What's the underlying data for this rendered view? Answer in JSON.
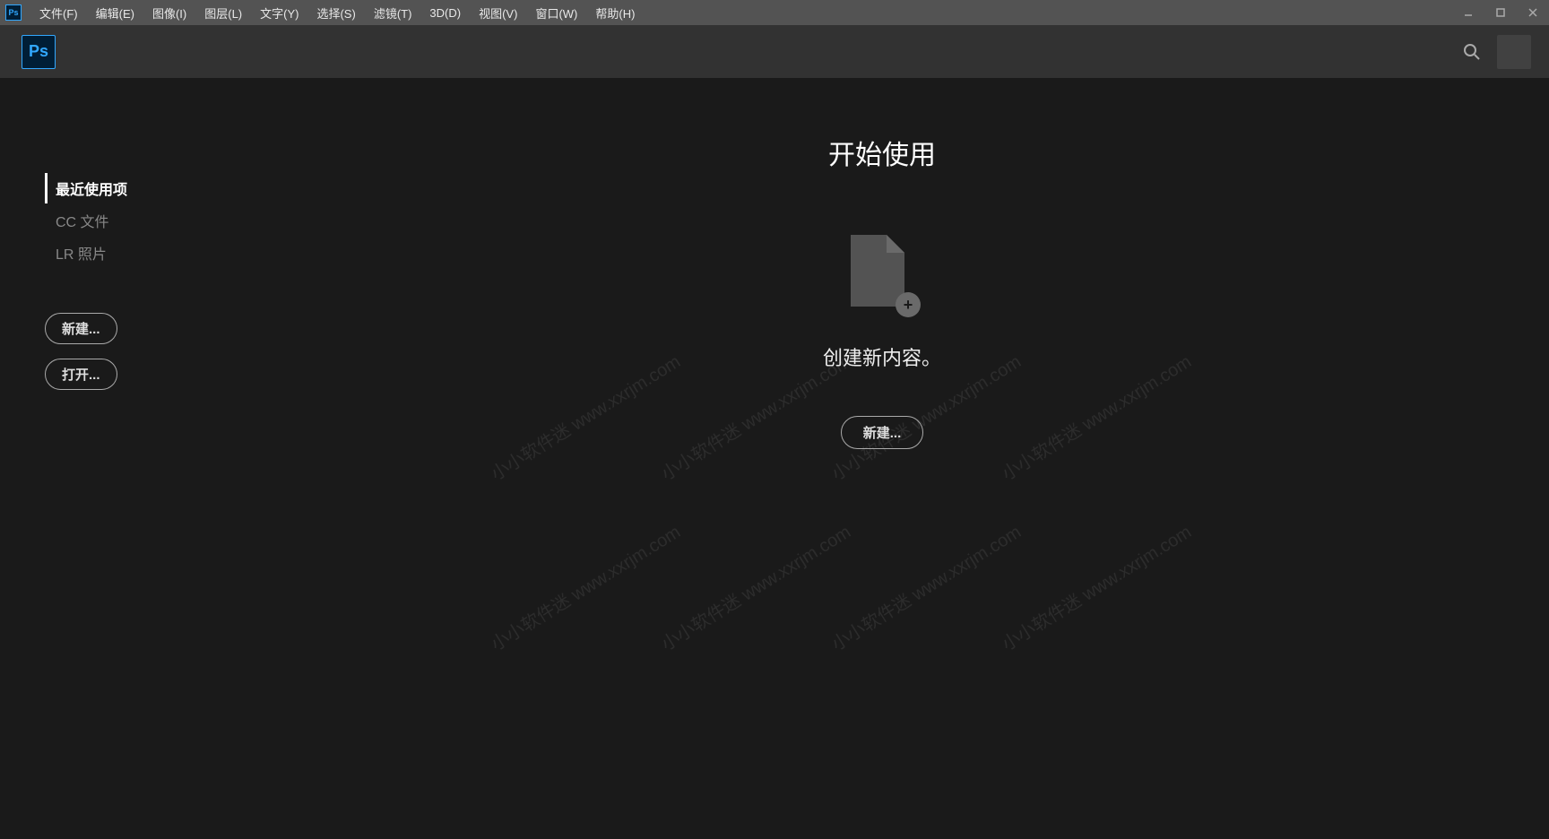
{
  "app_icon": "Ps",
  "menu": {
    "file": "文件(F)",
    "edit": "编辑(E)",
    "image": "图像(I)",
    "layer": "图层(L)",
    "type": "文字(Y)",
    "select": "选择(S)",
    "filter": "滤镜(T)",
    "3d": "3D(D)",
    "view": "视图(V)",
    "window": "窗口(W)",
    "help": "帮助(H)"
  },
  "sidebar": {
    "recent": "最近使用项",
    "cc_files": "CC 文件",
    "lr_photos": "LR 照片",
    "new_btn": "新建...",
    "open_btn": "打开..."
  },
  "main": {
    "title": "开始使用",
    "create_text": "创建新内容。",
    "new_btn": "新建..."
  },
  "watermark": "小小软件迷 www.xxrjm.com"
}
